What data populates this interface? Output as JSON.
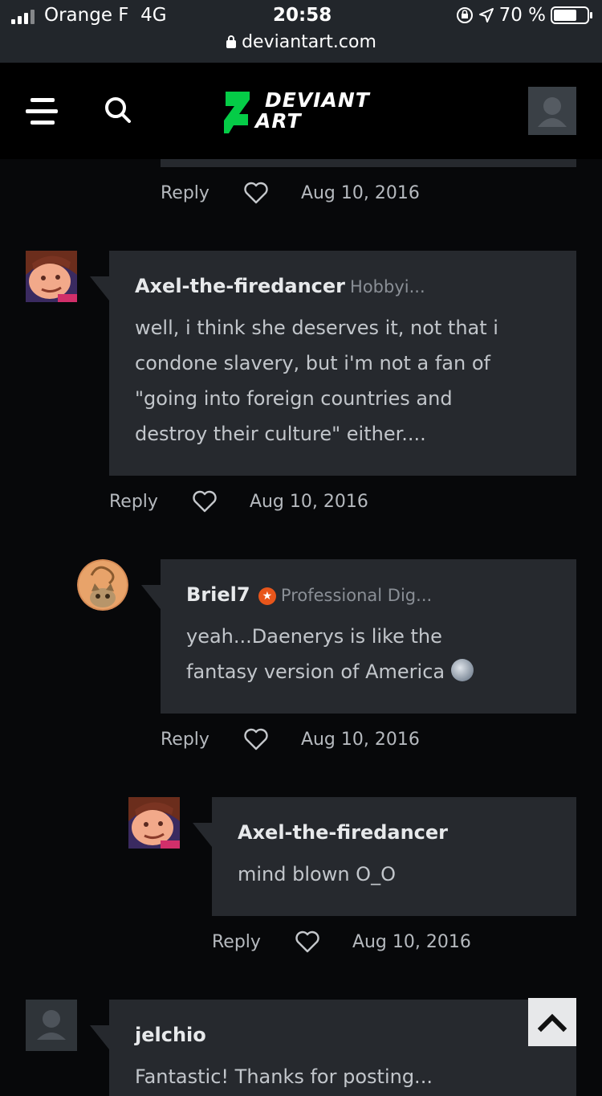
{
  "status_bar": {
    "carrier": "Orange F",
    "network": "4G",
    "time": "20:58",
    "battery": "70 %",
    "url": "deviantart.com"
  },
  "header": {
    "logo_line1": "DEVIANT",
    "logo_line2": "ART",
    "icons": [
      "menu-icon",
      "search-icon",
      "user-avatar"
    ],
    "accent_color": "#05cc47"
  },
  "comments": [
    {
      "reply_label": "Reply",
      "date": "Aug 10, 2016"
    },
    {
      "author": "Axel-the-firedancer",
      "role": "Hobbyi...",
      "text_lines": [
        "well, i think she deserves it, not that i",
        "condone slavery, but i'm not a fan of",
        "\"going into foreign countries and",
        "destroy their culture\" either...."
      ],
      "reply_label": "Reply",
      "date": "Aug 10, 2016"
    },
    {
      "author": "Briel7",
      "role": "Professional Dig...",
      "text_lines": [
        "yeah...Daenerys is like the",
        "fantasy version of America"
      ],
      "reply_label": "Reply",
      "date": "Aug 10, 2016"
    },
    {
      "author": "Axel-the-firedancer",
      "text_lines": [
        "mind blown O_O"
      ],
      "reply_label": "Reply",
      "date": "Aug 10, 2016"
    },
    {
      "author": "jelchio",
      "text_lines": [
        "Fantastic! Thanks for posting..."
      ]
    }
  ]
}
